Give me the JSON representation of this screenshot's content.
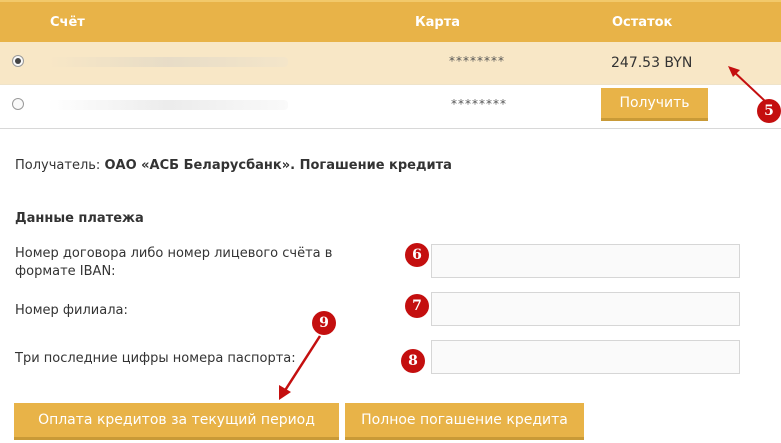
{
  "accounts_table": {
    "headers": {
      "account": "Счёт",
      "card": "Карта",
      "balance": "Остаток"
    },
    "rows": [
      {
        "card": "********",
        "balance": "247.53 BYN",
        "selected": true
      },
      {
        "card": "********",
        "button": "Получить",
        "selected": false
      }
    ]
  },
  "recipient": {
    "label": "Получатель:",
    "value": "ОАО «АСБ Беларусбанк». Погашение кредита"
  },
  "payment_data": {
    "title": "Данные платежа",
    "fields": [
      {
        "label": "Номер договора либо номер лицевого счёта в формате IBAN:",
        "value": ""
      },
      {
        "label": "Номер филиала:",
        "value": ""
      },
      {
        "label": "Три последние цифры номера паспорта:",
        "value": ""
      }
    ]
  },
  "buttons": {
    "pay_current": "Оплата кредитов за текущий период",
    "full_repayment": "Полное погашение кредита"
  },
  "markers": {
    "m5": "5",
    "m6": "6",
    "m7": "7",
    "m8": "8",
    "m9": "9"
  },
  "colors": {
    "accent": "#e8b348",
    "marker": "#c40f0f",
    "selected_row": "#f8e7c6"
  }
}
